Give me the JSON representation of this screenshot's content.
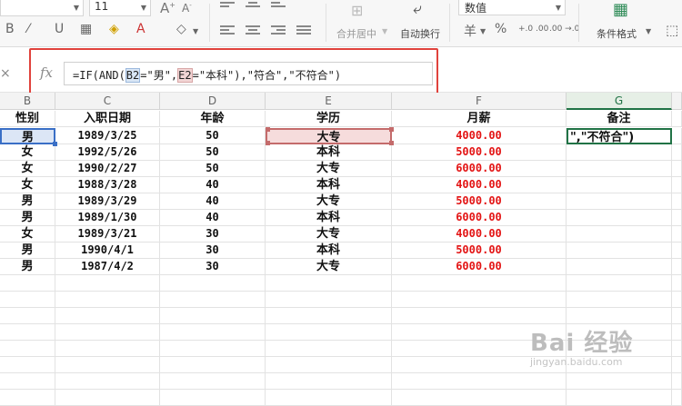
{
  "ribbon": {
    "font_name": "",
    "font_size": "11",
    "merge_label": "合并居中",
    "wrap_label": "自动换行",
    "number_format": "数值",
    "conditional_format_label": "条件格式",
    "currency_glyph": "羊",
    "percent_glyph": "%",
    "decimals_up": "+.0 .00",
    "decimals_down": ".00 →.0"
  },
  "formula_bar": {
    "fx_label": "fx",
    "close_glyph": "×",
    "segments": [
      {
        "text": "=IF(AND(",
        "ref": ""
      },
      {
        "text": "B2",
        "ref": "b"
      },
      {
        "text": "=\"男\",",
        "ref": ""
      },
      {
        "text": "E2",
        "ref": "e"
      },
      {
        "text": "=\"本科\"),\"符合\",\"不符合\")",
        "ref": ""
      }
    ]
  },
  "columns": [
    {
      "letter": "B",
      "selected": false
    },
    {
      "letter": "C",
      "selected": false
    },
    {
      "letter": "D",
      "selected": false
    },
    {
      "letter": "E",
      "selected": false
    },
    {
      "letter": "F",
      "selected": false
    },
    {
      "letter": "G",
      "selected": true
    }
  ],
  "table": {
    "headers": [
      "性别",
      "入职日期",
      "年龄",
      "学历",
      "月薪",
      "备注"
    ],
    "rows": [
      [
        "男",
        "1989/3/25",
        "50",
        "大专",
        "4000.00",
        "\",\"不符合\")"
      ],
      [
        "女",
        "1992/5/26",
        "50",
        "本科",
        "5000.00",
        ""
      ],
      [
        "女",
        "1990/2/27",
        "50",
        "大专",
        "6000.00",
        ""
      ],
      [
        "女",
        "1988/3/28",
        "40",
        "本科",
        "4000.00",
        ""
      ],
      [
        "男",
        "1989/3/29",
        "40",
        "大专",
        "5000.00",
        ""
      ],
      [
        "男",
        "1989/1/30",
        "40",
        "本科",
        "6000.00",
        ""
      ],
      [
        "女",
        "1989/3/21",
        "30",
        "大专",
        "4000.00",
        ""
      ],
      [
        "男",
        "1990/4/1",
        "30",
        "本科",
        "5000.00",
        ""
      ],
      [
        "男",
        "1987/4/2",
        "30",
        "大专",
        "6000.00",
        ""
      ]
    ]
  },
  "watermark": {
    "main": "Bai 经验",
    "sub": "jingyan.baidu.com"
  },
  "colors": {
    "salary_red": "#e31414",
    "accent_green": "#217346",
    "annotation_red": "#e0423c"
  }
}
